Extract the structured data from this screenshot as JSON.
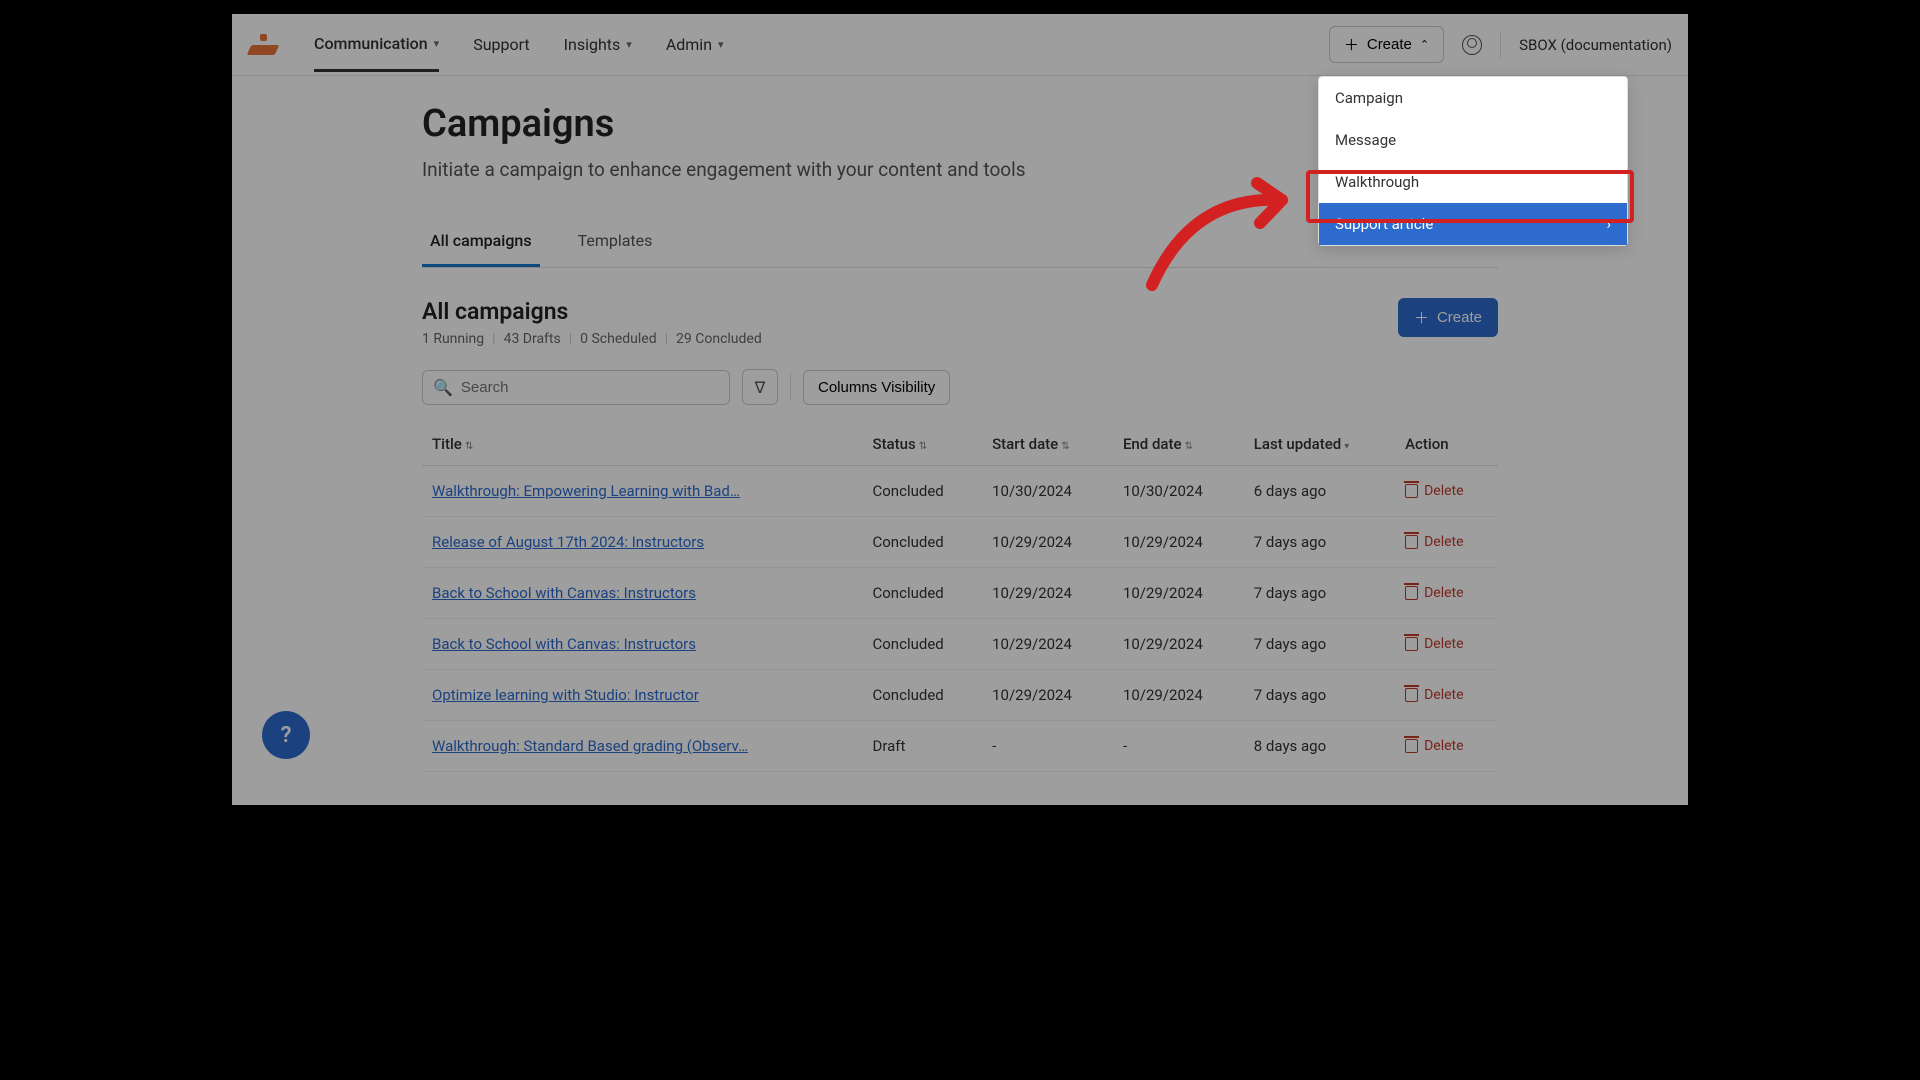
{
  "nav": {
    "items": [
      "Communication",
      "Support",
      "Insights",
      "Admin"
    ],
    "create": "Create",
    "env": "SBOX (documentation)"
  },
  "page": {
    "title": "Campaigns",
    "subtitle": "Initiate a campaign to enhance engagement with your content and tools"
  },
  "tabs": {
    "all": "All campaigns",
    "templates": "Templates"
  },
  "section": {
    "title": "All campaigns",
    "running": "1 Running",
    "drafts": "43 Drafts",
    "scheduled": "0 Scheduled",
    "concluded": "29 Concluded",
    "create": "Create"
  },
  "toolbar": {
    "search_placeholder": "Search",
    "colvis": "Columns Visibility"
  },
  "columns": {
    "title": "Title",
    "status": "Status",
    "start": "Start date",
    "end": "End date",
    "updated": "Last updated",
    "action": "Action"
  },
  "rows": [
    {
      "title": "Walkthrough: Empowering Learning with Bad…",
      "status": "Concluded",
      "start": "10/30/2024",
      "end": "10/30/2024",
      "updated": "6 days ago"
    },
    {
      "title": "Release of August 17th 2024: Instructors",
      "status": "Concluded",
      "start": "10/29/2024",
      "end": "10/29/2024",
      "updated": "7 days ago"
    },
    {
      "title": "Back to School with Canvas: Instructors",
      "status": "Concluded",
      "start": "10/29/2024",
      "end": "10/29/2024",
      "updated": "7 days ago"
    },
    {
      "title": "Back to School with Canvas: Instructors",
      "status": "Concluded",
      "start": "10/29/2024",
      "end": "10/29/2024",
      "updated": "7 days ago"
    },
    {
      "title": "Optimize learning with Studio: Instructor",
      "status": "Concluded",
      "start": "10/29/2024",
      "end": "10/29/2024",
      "updated": "7 days ago"
    },
    {
      "title": "Walkthrough: Standard Based grading (Observ…",
      "status": "Draft",
      "start": "-",
      "end": "-",
      "updated": "8 days ago"
    }
  ],
  "delete_label": "Delete",
  "dropdown": {
    "items": [
      "Campaign",
      "Message",
      "Walkthrough",
      "Support article"
    ]
  },
  "help": "?"
}
